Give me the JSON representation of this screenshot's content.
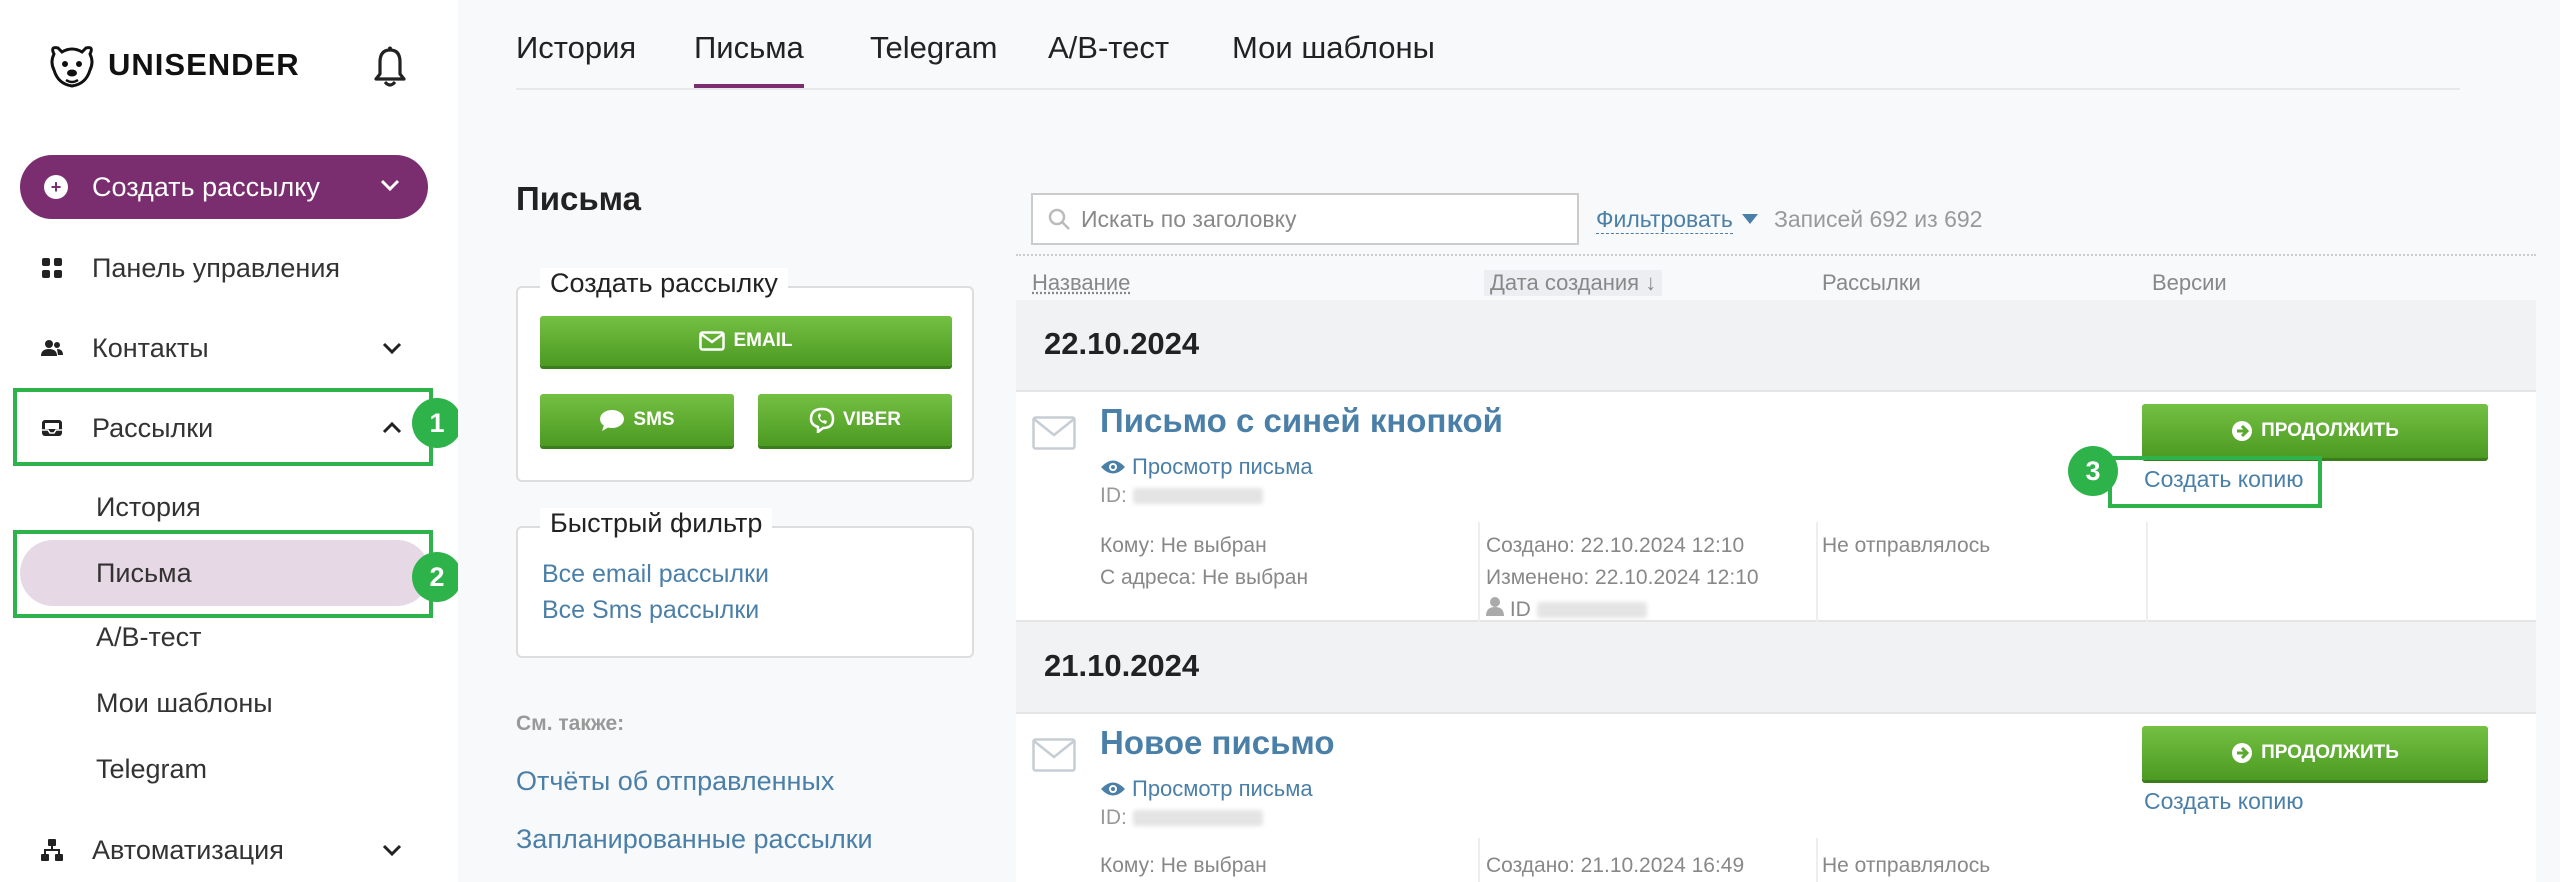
{
  "brand": {
    "name": "UNISENDER"
  },
  "sidebar": {
    "create_label": "Создать рассылку",
    "items": [
      {
        "label": "Панель управления",
        "icon": "grid-icon"
      },
      {
        "label": "Контакты",
        "icon": "contacts-icon"
      },
      {
        "label": "Рассылки",
        "icon": "mailbox-icon"
      },
      {
        "label": "Автоматизация",
        "icon": "automation-icon"
      }
    ],
    "subitems": [
      "История",
      "Письма",
      "A/B-тест",
      "Мои шаблоны",
      "Telegram"
    ]
  },
  "annotations": [
    "1",
    "2",
    "3"
  ],
  "tabs": [
    "История",
    "Письма",
    "Telegram",
    "A/B-тест",
    "Мои шаблоны"
  ],
  "page": {
    "title": "Письма",
    "create_box": {
      "legend": "Создать рассылку",
      "email": "EMAIL",
      "sms": "SMS",
      "viber": "VIBER"
    },
    "quick_filter": {
      "legend": "Быстрый фильтр",
      "links": [
        "Все email рассылки",
        "Все Sms рассылки"
      ]
    },
    "see_also": {
      "label": "См. также:",
      "links": [
        "Отчёты об отправленных",
        "Запланированные рассылки"
      ]
    }
  },
  "list": {
    "search_placeholder": "Искать по заголовку",
    "filter_label": "Фильтровать",
    "records": "Записей 692 из 692",
    "columns": [
      "Название",
      "Дата создания ↓",
      "Рассылки",
      "Версии"
    ],
    "groups": [
      {
        "date": "22.10.2024",
        "title": "Письмо с синей кнопкой",
        "preview": "Просмотр письма",
        "id_label": "ID:",
        "to": "Кому: Не выбран",
        "from": "С адреса: Не выбран",
        "created": "Создано: 22.10.2024 12:10",
        "modified": "Изменено: 22.10.2024 12:10",
        "owner": "ID",
        "status": "Не отправлялось",
        "continue": "ПРОДОЛЖИТЬ",
        "copy": "Создать копию"
      },
      {
        "date": "21.10.2024",
        "title": "Новое письмо",
        "preview": "Просмотр письма",
        "id_label": "ID:",
        "to": "Кому: Не выбран",
        "created": "Создано: 21.10.2024 16:49",
        "status": "Не отправлялось",
        "continue": "ПРОДОЛЖИТЬ",
        "copy": "Создать копию"
      }
    ]
  },
  "colors": {
    "brand": "#7b2e6f",
    "active_bg": "#e7d8e5",
    "annotation": "#2db34a",
    "button_green": "#5aa82e",
    "link": "#4a7fa8"
  }
}
